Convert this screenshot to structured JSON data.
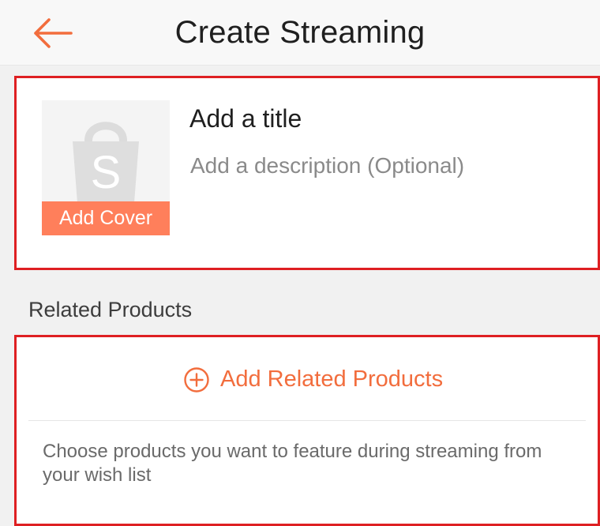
{
  "header": {
    "title": "Create Streaming",
    "back_icon": "arrow-left-icon"
  },
  "stream_info": {
    "cover_icon": "shopping-bag-icon",
    "cover_letter": "S",
    "cover_button_label": "Add Cover",
    "title_placeholder": "Add a title",
    "description_placeholder": "Add a description (Optional)"
  },
  "related_products": {
    "section_label": "Related Products",
    "add_icon": "plus-circle-icon",
    "add_button_label": "Add Related Products",
    "help_text": "Choose products you want to feature during streaming from your wish list"
  },
  "colors": {
    "accent": "#f26d3d",
    "cover_button": "#ff7f5b",
    "highlight_outline": "#de1f22",
    "background": "#f1f1f1"
  }
}
